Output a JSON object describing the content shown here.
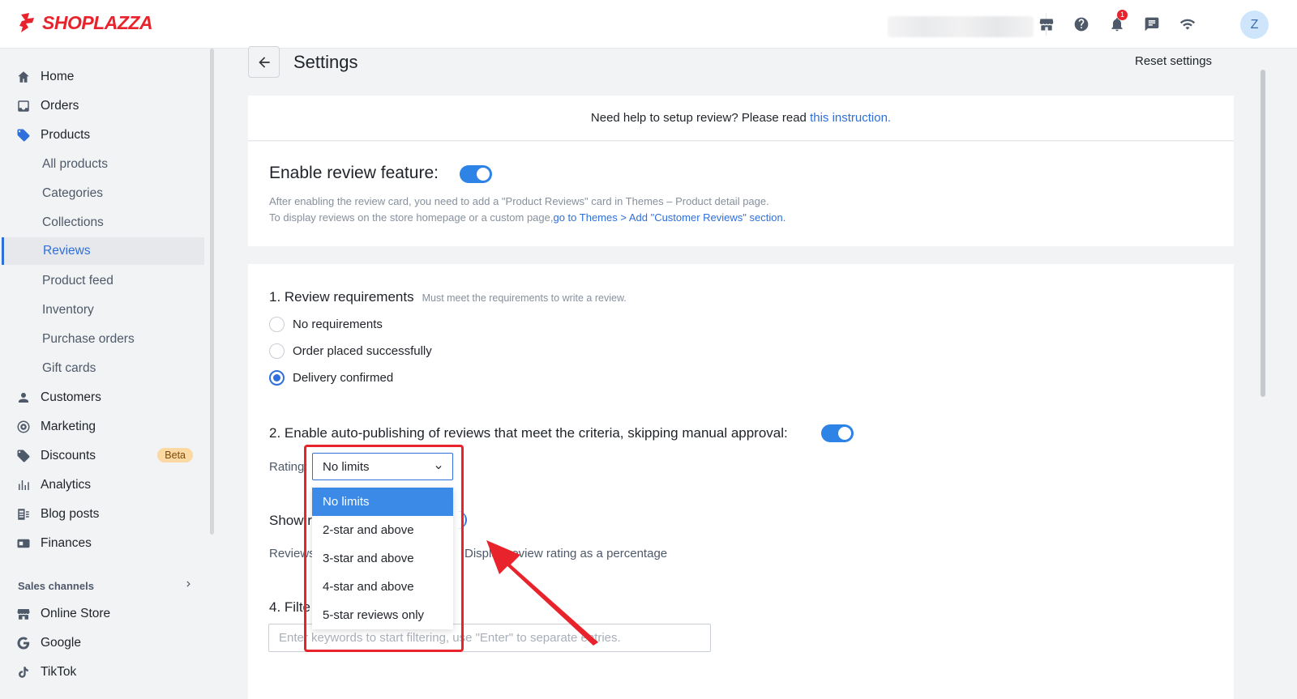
{
  "brand": {
    "name": "SHOPLAZZA",
    "color": "#e8232b"
  },
  "topbar": {
    "icons": [
      "store-icon",
      "help-icon",
      "bell-icon",
      "chat-icon",
      "wifi-icon"
    ],
    "notification_count": "1",
    "avatar_initial": "Z"
  },
  "sidebar": {
    "items": [
      {
        "label": "Home",
        "icon": "home-icon"
      },
      {
        "label": "Orders",
        "icon": "inbox-icon"
      },
      {
        "label": "Products",
        "icon": "tag-icon"
      },
      {
        "label": "All products"
      },
      {
        "label": "Categories"
      },
      {
        "label": "Collections"
      },
      {
        "label": "Reviews",
        "active": true
      },
      {
        "label": "Product feed"
      },
      {
        "label": "Inventory"
      },
      {
        "label": "Purchase orders"
      },
      {
        "label": "Gift cards"
      },
      {
        "label": "Customers",
        "icon": "person-icon"
      },
      {
        "label": "Marketing",
        "icon": "target-icon"
      },
      {
        "label": "Discounts",
        "icon": "discount-tag-icon",
        "badge": "Beta"
      },
      {
        "label": "Analytics",
        "icon": "bar-chart-icon"
      },
      {
        "label": "Blog posts",
        "icon": "blog-icon"
      },
      {
        "label": "Finances",
        "icon": "wallet-icon"
      }
    ],
    "sales_channels_label": "Sales channels",
    "channels": [
      {
        "label": "Online Store",
        "icon": "store-icon"
      },
      {
        "label": "Google",
        "icon": "google-icon"
      },
      {
        "label": "TikTok",
        "icon": "tiktok-icon"
      }
    ]
  },
  "header": {
    "title": "Settings",
    "reset_label": "Reset settings"
  },
  "help": {
    "text": "Need help to setup review? Please read ",
    "link": "this instruction."
  },
  "enable": {
    "title": "Enable review feature:",
    "enabled": true,
    "desc_line1": "After enabling the review card, you need to add a \"Product Reviews\" card in Themes – Product detail page.",
    "desc_line2_prefix": "To display reviews on the store homepage or a custom page,",
    "desc_line2_link": "go to Themes > Add \"Customer Reviews\" section."
  },
  "requirements": {
    "title": "1. Review requirements",
    "hint": "Must meet the requirements to write a review.",
    "options": [
      "No requirements",
      "Order placed successfully",
      "Delivery confirmed"
    ],
    "selected": "Delivery confirmed"
  },
  "auto_publish": {
    "title": "2. Enable auto-publishing of reviews that meet the criteria, skipping manual approval:",
    "enabled": true,
    "rating_label": "Rating:",
    "selected": "No limits",
    "options": [
      "No limits",
      "2-star and above",
      "3-star and above",
      "4-star and above",
      "5-star reviews only"
    ]
  },
  "show": {
    "title_partial": "Show r",
    "reviews_label_partial": "Reviews",
    "display_label_partial": "Display review rating as a percentage"
  },
  "filter": {
    "title_partial": "4. Filte",
    "placeholder": "Enter keywords to start filtering, use \"Enter\" to separate entries."
  },
  "annotation_color": "#e8232b"
}
